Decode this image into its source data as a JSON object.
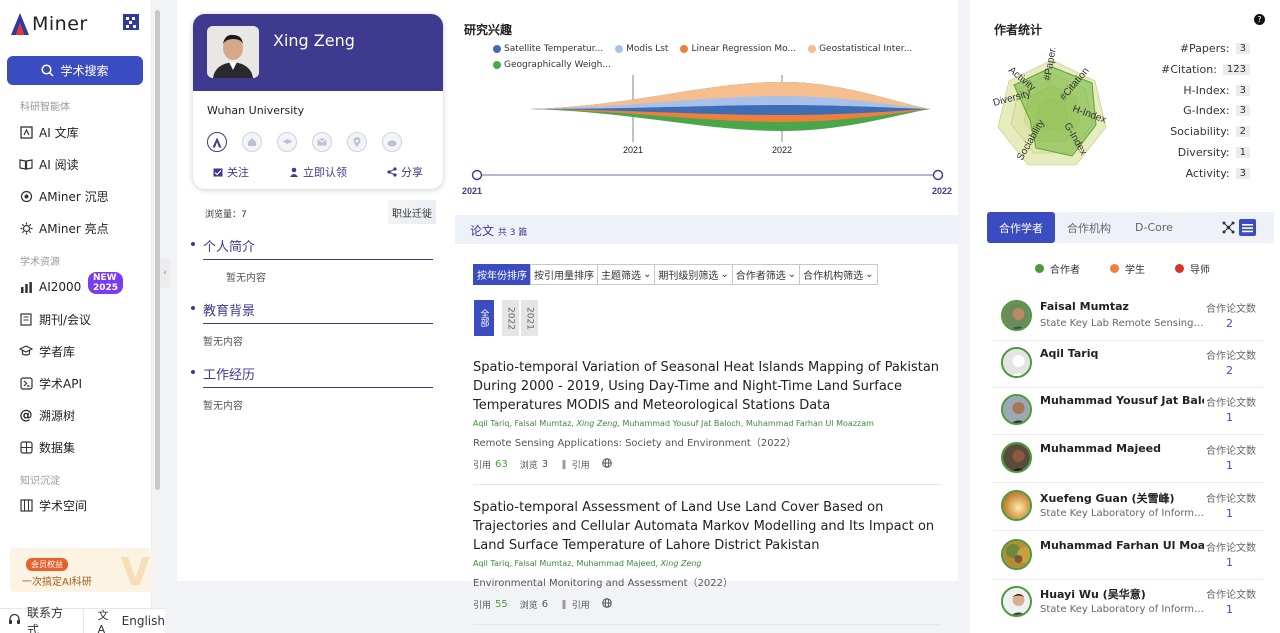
{
  "sidebar": {
    "logo_text": "Miner",
    "logo_letter": "A",
    "search_label": "学术搜索",
    "section1": "科研智能体",
    "section2": "学术资源",
    "section3": "知识沉淀",
    "items": [
      {
        "label": "AI 文库",
        "icon": "file-ai-icon"
      },
      {
        "label": "AI 阅读",
        "icon": "book-open-icon"
      },
      {
        "label": "AMiner 沉思",
        "icon": "brain-icon"
      },
      {
        "label": "AMiner 亮点",
        "icon": "gear-spark-icon"
      },
      {
        "label": "AI2000",
        "icon": "bar-chart-icon",
        "badge": "NEW 2025"
      },
      {
        "label": "期刊/会议",
        "icon": "journal-icon"
      },
      {
        "label": "学者库",
        "icon": "graduation-cap-icon"
      },
      {
        "label": "学术API",
        "icon": "api-icon"
      },
      {
        "label": "溯源树",
        "icon": "at-tree-icon"
      },
      {
        "label": "数据集",
        "icon": "dataset-icon"
      },
      {
        "label": "学术空间",
        "icon": "space-icon"
      }
    ],
    "promo_tag": "会员权益",
    "promo_text": "一次搞定AI科研",
    "promo_mark": "V",
    "contact_label": "联系方式",
    "language_label": "English"
  },
  "profile": {
    "name": "Xing Zeng",
    "institution": "Wuhan University",
    "follow_label": "关注",
    "claim_label": "立即认领",
    "share_label": "分享",
    "views_text": "浏览量：7",
    "career_label": "职业迁徙",
    "bio_title": "个人简介",
    "bio_value": "暂无内容",
    "edu_title": "教育背景",
    "edu_value": "暂无内容",
    "work_title": "工作经历",
    "work_value": "暂无内容"
  },
  "interests": {
    "title": "研究兴趣",
    "legend": [
      {
        "label": "Satellite Temperatur...",
        "color": "#3d6db4"
      },
      {
        "label": "Modis Lst",
        "color": "#a9c1ea"
      },
      {
        "label": "Linear Regression Mo...",
        "color": "#f07f3c"
      },
      {
        "label": "Geostatistical Inter...",
        "color": "#f5be8c"
      },
      {
        "label": "Geographically Weigh...",
        "color": "#4aa64a"
      }
    ],
    "axis_labels": [
      "2021",
      "2022"
    ],
    "timeline_start": "2021",
    "timeline_end": "2022"
  },
  "papers": {
    "tab_label": "论文",
    "count_text": "共 3 篇",
    "filters": [
      "按年份排序",
      "按引用量排序",
      "主题筛选",
      "期刊级别筛选",
      "合作者筛选",
      "合作机构筛选"
    ],
    "year_all": "全部",
    "years": [
      "2022",
      "2021"
    ],
    "items": [
      {
        "title": "Spatio-temporal Variation of Seasonal Heat Islands Mapping of Pakistan During 2000 - 2019, Using Day-Time and Night-Time Land Surface Temperatures MODIS and Meteorological Stations Data",
        "authors_a": "Aqil Tariq,  Faisal Mumtaz,",
        "authors_em": "Xing Zeng,",
        "authors_b": " Muhammad Yousuf Jat Baloch,  Muhammad Farhan Ul Moazzam",
        "venue": "Remote Sensing Applications: Society and Environment（2022）",
        "cite_label": "引用",
        "cite_count": "63",
        "view_label": "浏览",
        "view_count": "3",
        "ref_label": "引用"
      },
      {
        "title": "Spatio-temporal Assessment of Land Use Land Cover Based on Trajectories and Cellular Automata Markov Modelling and Its Impact on Land Surface Temperature of Lahore District Pakistan",
        "authors_a": "Aqil Tariq,  Faisal Mumtaz,  Muhammad Majeed,",
        "authors_em": "Xing Zeng",
        "authors_b": "",
        "venue": "Environmental Monitoring and Assessment（2022）",
        "cite_label": "引用",
        "cite_count": "55",
        "view_label": "浏览",
        "view_count": "6",
        "ref_label": "引用"
      }
    ]
  },
  "stats": {
    "title": "作者统计",
    "help": "?",
    "rows": [
      {
        "label": "#Papers:",
        "value": "3"
      },
      {
        "label": "#Citation:",
        "value": "123"
      },
      {
        "label": "H-Index:",
        "value": "3"
      },
      {
        "label": "G-Index:",
        "value": "3"
      },
      {
        "label": "Sociability:",
        "value": "2"
      },
      {
        "label": "Diversity:",
        "value": "1"
      },
      {
        "label": "Activity:",
        "value": "3"
      }
    ],
    "radar_axes": [
      "#Papers",
      "#Citation",
      "H-Index",
      "G-Index",
      "Sociability",
      "Diversity",
      "Activity"
    ]
  },
  "coauthors": {
    "tabs": [
      "合作学者",
      "合作机构",
      "D-Core"
    ],
    "legend": [
      {
        "label": "合作者",
        "color": "#4a9a3a"
      },
      {
        "label": "学生",
        "color": "#f07f3c"
      },
      {
        "label": "导师",
        "color": "#d9342b"
      }
    ],
    "count_label": "合作论文数",
    "list": [
      {
        "name": "Faisal Mumtaz",
        "aff": "State Key Lab Remote Sensing Sci, ...",
        "count": "2"
      },
      {
        "name": "Aqil Tariq",
        "aff": "",
        "count": "2"
      },
      {
        "name": "Muhammad Yousuf Jat Baloch",
        "aff": "",
        "count": "1"
      },
      {
        "name": "Muhammad Majeed",
        "aff": "",
        "count": "1"
      },
      {
        "name": "Xuefeng Guan (关雪峰)",
        "aff": "State Key Laboratory of Information...",
        "count": "1"
      },
      {
        "name": "Muhammad Farhan Ul Moazzam",
        "aff": "",
        "count": "1"
      },
      {
        "name": "Huayi Wu (吴华意)",
        "aff": "State Key Laboratory of Information...",
        "count": "1"
      }
    ]
  }
}
